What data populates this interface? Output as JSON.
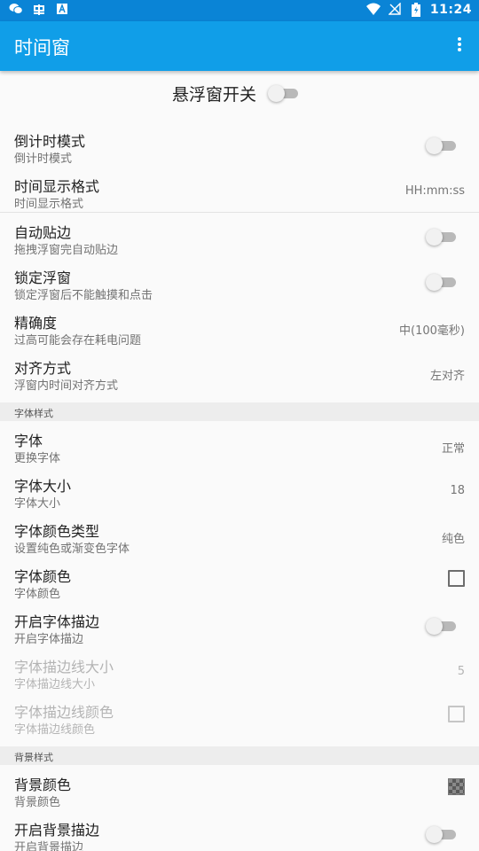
{
  "status": {
    "time": "11:24",
    "left_icons": [
      "wechat-icon",
      "bug-app-icon",
      "a-box-icon"
    ],
    "right_icons": [
      "wifi-icon",
      "no-signal-icon",
      "battery-charging-icon"
    ]
  },
  "appbar": {
    "title": "时间窗",
    "menu_icon": "more-vert-icon"
  },
  "master": {
    "label": "悬浮窗开关",
    "on": false
  },
  "rows_general": [
    {
      "title": "倒计时模式",
      "subtitle": "倒计时模式",
      "kind": "switch",
      "on": false
    },
    {
      "title": "时间显示格式",
      "subtitle": "时间显示格式",
      "kind": "value",
      "value": "HH:mm:ss"
    },
    {
      "title": "自动贴边",
      "subtitle": "拖拽浮窗完自动贴边",
      "kind": "switch",
      "on": false
    },
    {
      "title": "锁定浮窗",
      "subtitle": "锁定浮窗后不能触摸和点击",
      "kind": "switch",
      "on": false
    },
    {
      "title": "精确度",
      "subtitle": "过高可能会存在耗电问题",
      "kind": "value",
      "value": "中(100毫秒)"
    },
    {
      "title": "对齐方式",
      "subtitle": "浮窗内时间对齐方式",
      "kind": "value",
      "value": "左对齐"
    }
  ],
  "section_font": {
    "label": "字体样式"
  },
  "rows_font": [
    {
      "title": "字体",
      "subtitle": "更换字体",
      "kind": "value",
      "value": "正常"
    },
    {
      "title": "字体大小",
      "subtitle": "字体大小",
      "kind": "value",
      "value": "18"
    },
    {
      "title": "字体颜色类型",
      "subtitle": "设置纯色或渐变色字体",
      "kind": "value",
      "value": "纯色"
    },
    {
      "title": "字体颜色",
      "subtitle": "字体颜色",
      "kind": "checkbox",
      "checked": false
    },
    {
      "title": "开启字体描边",
      "subtitle": "开启字体描边",
      "kind": "switch",
      "on": false
    },
    {
      "title": "字体描边线大小",
      "subtitle": "字体描边线大小",
      "kind": "value",
      "value": "5",
      "disabled": true
    },
    {
      "title": "字体描边线颜色",
      "subtitle": "字体描边线颜色",
      "kind": "checkbox",
      "checked": false,
      "disabled": true
    }
  ],
  "section_bg": {
    "label": "背景样式"
  },
  "rows_bg": [
    {
      "title": "背景颜色",
      "subtitle": "背景颜色",
      "kind": "swatch"
    },
    {
      "title": "开启背景描边",
      "subtitle": "开启背景描边",
      "kind": "switch",
      "on": false
    }
  ],
  "colors": {
    "appbar": "#109ee8",
    "statusbar": "#0a84d6",
    "background": "#fafafa"
  }
}
